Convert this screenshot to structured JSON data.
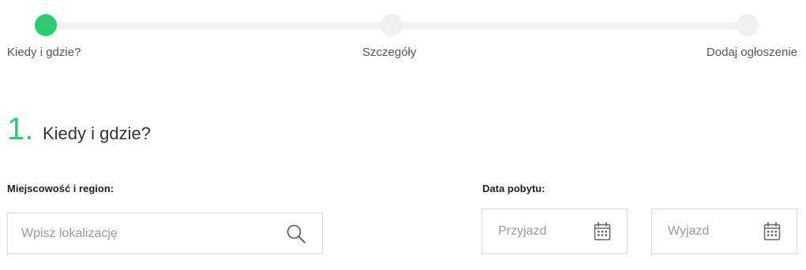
{
  "stepper": {
    "steps": [
      {
        "label": "Kiedy i gdzie?",
        "active": true
      },
      {
        "label": "Szczegóły",
        "active": false
      },
      {
        "label": "Dodaj ogłoszenie",
        "active": false
      }
    ],
    "active_color": "#2ecc71",
    "inactive_color": "#f0f0f0"
  },
  "section": {
    "number": "1.",
    "title": "Kiedy i gdzie?"
  },
  "location": {
    "label": "Miejscowość i region:",
    "placeholder": "Wpisz lokalizację",
    "icon": "search-icon"
  },
  "stay_dates": {
    "label": "Data pobytu:",
    "arrival_placeholder": "Przyjazd",
    "departure_placeholder": "Wyjazd",
    "icon": "calendar-icon"
  }
}
